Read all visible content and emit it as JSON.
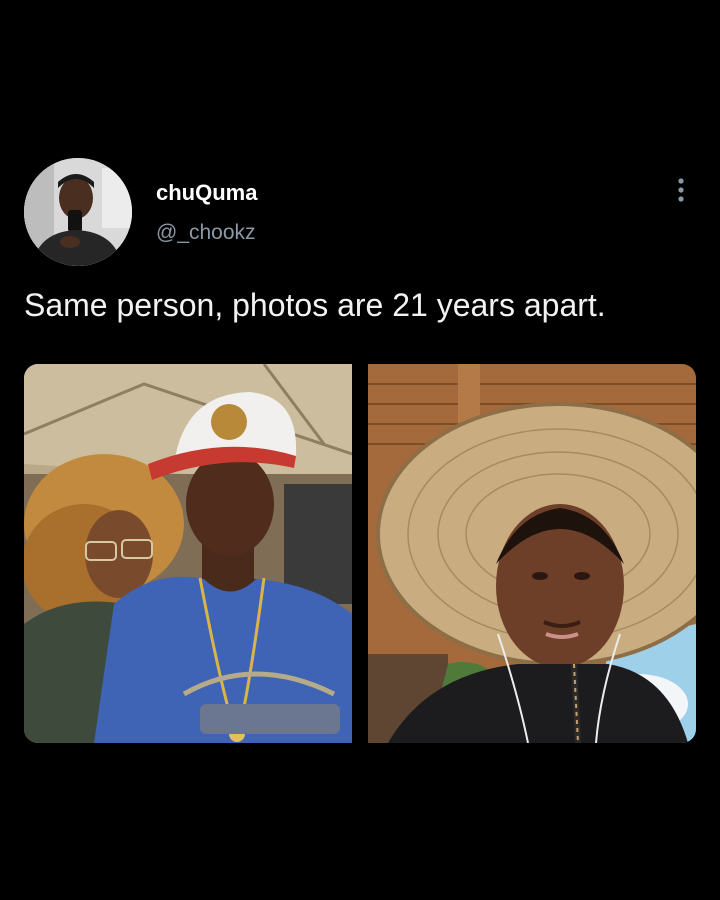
{
  "tweet": {
    "author": {
      "display_name": "chuQuma",
      "handle": "@_chookz",
      "avatar_icon": "profile-photo"
    },
    "text": "Same person, photos are 21 years apart.",
    "more_icon": "vertical-ellipsis-icon",
    "media": [
      {
        "description_icon": "photo-man-in-red-cap-blue-tee"
      },
      {
        "description_icon": "photo-man-in-straw-hat"
      }
    ]
  },
  "colors": {
    "background": "#000000",
    "text_primary": "#ffffff",
    "text_secondary": "#8b98a5"
  }
}
